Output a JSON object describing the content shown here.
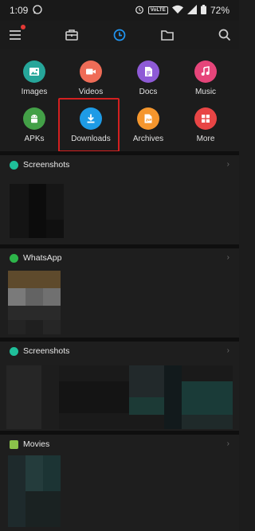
{
  "status": {
    "time": "1:09",
    "network_badge": "VoLTE",
    "battery": "72%"
  },
  "toolbar": {
    "icons": [
      "menu-icon",
      "toolbox-icon",
      "recent-clock-icon",
      "folder-icon",
      "search-icon"
    ],
    "active_color": "#2196f3"
  },
  "categories": [
    {
      "label": "Images",
      "color": "#26a69a",
      "icon": "image-icon"
    },
    {
      "label": "Videos",
      "color": "#ef6c57",
      "icon": "video-icon"
    },
    {
      "label": "Docs",
      "color": "#8e5ad6",
      "icon": "doc-icon"
    },
    {
      "label": "Music",
      "color": "#e6457a",
      "icon": "music-icon"
    },
    {
      "label": "APKs",
      "color": "#43a047",
      "icon": "android-icon"
    },
    {
      "label": "Downloads",
      "color": "#1e9be6",
      "icon": "download-icon"
    },
    {
      "label": "Archives",
      "color": "#f5962d",
      "icon": "zip-icon"
    },
    {
      "label": "More",
      "color": "#e84545",
      "icon": "grid-icon"
    }
  ],
  "sections": [
    {
      "title": "Screenshots",
      "color": "#1fbf9a"
    },
    {
      "title": "WhatsApp",
      "color": "#2db54a"
    },
    {
      "title": "Screenshots",
      "color": "#1fbf9a"
    },
    {
      "title": "Movies",
      "color": "#8bc34a"
    }
  ]
}
